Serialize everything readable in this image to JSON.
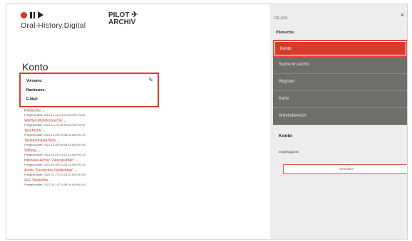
{
  "brand": {
    "name": "Oral-History.Digital",
    "partner_line1": "PILOT",
    "partner_line2": "ARCHIV",
    "plane_icon": "airplane-icon"
  },
  "main": {
    "title": "Konto",
    "profile_fields": [
      "Vorname:",
      "Nachname:",
      "E-Mail:"
    ],
    "entries": [
      {
        "title": "Pilotarchiv",
        "date": "Freigeschaltet: 2021-11-11T14:29:00.000+01:00"
      },
      {
        "title": "Werften Munitionsarchiv",
        "date": "Freigeschaltet: 2021-11-11T15:35:32.000+01:00"
      },
      {
        "title": "Test Archiv",
        "date": "Freigeschaltet: 2021-12-09T14:38:02.000+01:00"
      },
      {
        "title": "Testsammlung Beta",
        "date": "Freigeschaltet: 2021-12-09T09:48:16.000+01:00"
      },
      {
        "title": "Stiftung",
        "date": "Freigeschaltet: 2021-10-21T13:12:14.000+02:00"
      },
      {
        "title": "Interview-Archiv \"Zwangsarbeit\"",
        "date": "Freigeschaltet: 2021-10-30T13:33:23.000+02:00"
      },
      {
        "title": "Archiv \"Deutsches Gedächtnis\"",
        "date": "Freigeschaltet: 2022-01-17T10:13:24.000+01:00"
      },
      {
        "title": "ALE Testarchiv",
        "date": "Freigeschaltet: 2022-09-14T14:55:26.000+02:00"
      }
    ]
  },
  "sidebar": {
    "lang": "DE | EN",
    "close": "×",
    "breadcrumb": "Pilotarchiv",
    "menu": [
      "Konto",
      "Suche im Archiv",
      "Register",
      "Karte",
      "Arbeitsbereich"
    ],
    "heading": "Konto",
    "status": "Eingeloggt als",
    "logout": "Abmelden"
  },
  "colors": {
    "accent": "#d0342c",
    "sidebar_bg": "#ededed",
    "menu_bg": "#6f6f6a"
  }
}
